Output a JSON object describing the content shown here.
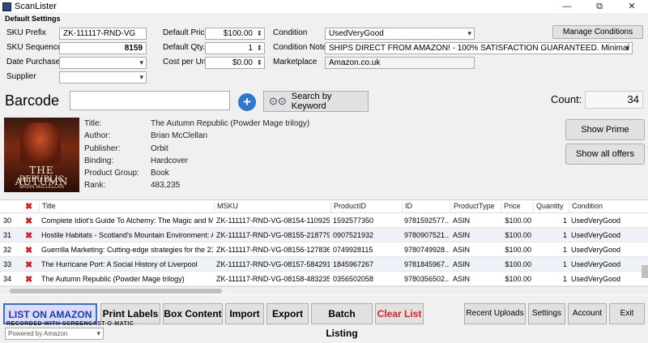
{
  "window": {
    "title": "ScanLister",
    "minimize": "—",
    "restore": "⧉",
    "close": "✕"
  },
  "settings": {
    "header": "Default Settings",
    "sku_prefix_label": "SKU Prefix",
    "sku_prefix": "ZK-111117-RND-VG",
    "sku_sequence_label": "SKU Sequence",
    "sku_sequence": "8159",
    "date_purchased_label": "Date Purchased",
    "date_purchased": "",
    "supplier_label": "Supplier",
    "supplier": "",
    "default_price_label": "Default Price",
    "default_price": "$100.00",
    "default_qty_label": "Default Qty.",
    "default_qty": "1",
    "cost_per_unit_label": "Cost per Unit",
    "cost_per_unit": "$0.00",
    "condition_label": "Condition",
    "condition": "UsedVeryGood",
    "condition_note_label": "Condition Note",
    "condition_note": "SHIPS DIRECT FROM AMAZON! - 100% SATISFACTION GUARANTEED. Minimal signs of we...",
    "marketplace_label": "Marketplace",
    "marketplace": "Amazon.co.uk",
    "manage_conditions": "Manage Conditions"
  },
  "barcode": {
    "label": "Barcode",
    "value": "",
    "add": "+",
    "search_keyword": "Search by Keyword",
    "count_label": "Count:",
    "count": "34"
  },
  "product": {
    "cover_title_1": "THE AUTUMN",
    "cover_title_2": "REPUBLIC",
    "cover_author": "BRIAN McCLELLAN",
    "title_label": "Title:",
    "title": "The Autumn Republic (Powder Mage trilogy)",
    "author_label": "Author:",
    "author": "Brian McClellan",
    "publisher_label": "Publisher:",
    "publisher": "Orbit",
    "binding_label": "Binding:",
    "binding": "Hardcover",
    "product_group_label": "Product Group:",
    "product_group": "Book",
    "rank_label": "Rank:",
    "rank": "483,235",
    "show_prime": "Show Prime",
    "show_all_offers": "Show all offers"
  },
  "grid": {
    "columns": [
      "Title",
      "MSKU",
      "ProductID",
      "ID",
      "ProductType",
      "Price",
      "Quantity",
      "Condition"
    ],
    "rows": [
      {
        "num": "30",
        "title": "Complete Idiot's Guide To Alchemy: The Magic and Myste...",
        "msku": "ZK-111117-RND-VG-08154-110925",
        "pid": "1592577350",
        "id": "9781592577...",
        "type": "ASIN",
        "price": "$100.00",
        "qty": "1",
        "cond": "UsedVeryGood"
      },
      {
        "num": "31",
        "title": "Hostile Habitats - Scotland's Mountain Environment: A Hill...",
        "msku": "ZK-111117-RND-VG-08155-218779",
        "pid": "0907521932",
        "id": "9780907521...",
        "type": "ASIN",
        "price": "$100.00",
        "qty": "1",
        "cond": "UsedVeryGood"
      },
      {
        "num": "32",
        "title": "Guerrilla Marketing: Cutting-edge strategies for the 21st ...",
        "msku": "ZK-111117-RND-VG-08156-127836",
        "pid": "0749928115",
        "id": "9780749928...",
        "type": "ASIN",
        "price": "$100.00",
        "qty": "1",
        "cond": "UsedVeryGood"
      },
      {
        "num": "33",
        "title": "The Hurricane Port: A Social History of Liverpool",
        "msku": "ZK-111117-RND-VG-08157-584291",
        "pid": "1845967267",
        "id": "9781845967...",
        "type": "ASIN",
        "price": "$100.00",
        "qty": "1",
        "cond": "UsedVeryGood"
      },
      {
        "num": "34",
        "title": "The Autumn Republic (Powder Mage trilogy)",
        "msku": "ZK-111117-RND-VG-08158-483235",
        "pid": "0356502058",
        "id": "9780356502...",
        "type": "ASIN",
        "price": "$100.00",
        "qty": "1",
        "cond": "UsedVeryGood"
      }
    ]
  },
  "actions": {
    "list_on_amazon": "LIST ON AMAZON",
    "print_labels": "Print Labels",
    "box_content": "Box Content",
    "import": "Import",
    "export": "Export",
    "batch_listing": "Batch Listing",
    "clear_list": "Clear List",
    "recent_uploads": "Recent Uploads",
    "settings": "Settings",
    "account": "Account",
    "exit": "Exit"
  },
  "footer": {
    "powered": "Powered by Amazon",
    "watermark": "RECORDED WITH SCREENCAST-O-MATIC"
  }
}
